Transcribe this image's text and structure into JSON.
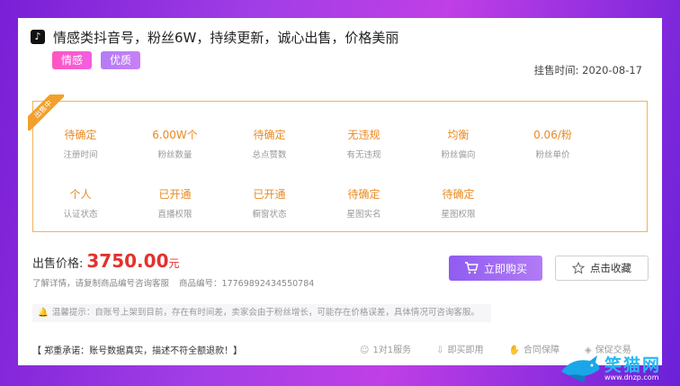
{
  "listing": {
    "title": "情感类抖音号，粉丝6W，持续更新，诚心出售，价格美丽",
    "tags": [
      "情感",
      "优质"
    ],
    "post_time": "挂售时间: 2020-08-17",
    "ribbon": "出售中"
  },
  "stats": [
    {
      "value": "待确定",
      "label": "注册时间"
    },
    {
      "value": "6.00W个",
      "label": "粉丝数量"
    },
    {
      "value": "待确定",
      "label": "总点赞数"
    },
    {
      "value": "无违规",
      "label": "有无违规"
    },
    {
      "value": "均衡",
      "label": "粉丝偏向"
    },
    {
      "value": "0.06/粉",
      "label": "粉丝单价"
    },
    {
      "value": "个人",
      "label": "认证状态"
    },
    {
      "value": "已开通",
      "label": "直播权限"
    },
    {
      "value": "已开通",
      "label": "橱窗状态"
    },
    {
      "value": "待确定",
      "label": "星图实名"
    },
    {
      "value": "待确定",
      "label": "星图权限"
    }
  ],
  "price": {
    "label": "出售价格:",
    "amount": "3750.00",
    "unit": "元"
  },
  "desc": {
    "hint": "了解详情，请复制商品编号咨询客服",
    "code": "商品编号：17769892434550784"
  },
  "buttons": {
    "buy": "立即购买",
    "favorite": "点击收藏"
  },
  "notice": "温馨提示：自账号上架到目前，存在有时间差，卖家会由于粉丝增长，可能存在价格误差，具体情况可咨询客服。",
  "promise": "【 郑重承诺：账号数据真实，描述不符全额退款！】",
  "features": [
    "1对1服务",
    "即买即用",
    "合同保障",
    "保促交易"
  ],
  "watermark": {
    "line1": "笑猫网",
    "line2": "www.dnzp.com"
  },
  "colors": {
    "accent": "#e98a23",
    "price": "#e3322c",
    "buy": "#9b64f2"
  }
}
